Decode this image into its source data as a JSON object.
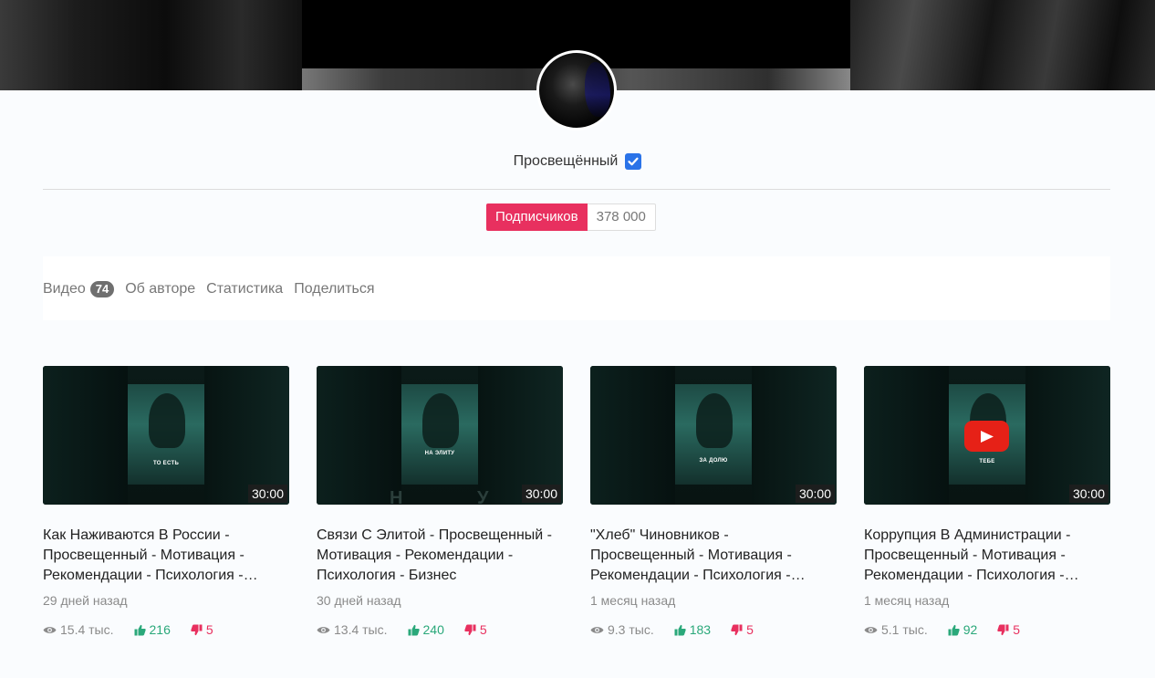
{
  "channel": {
    "name": "Просвещённый",
    "subscribe_label": "Подписчиков",
    "subscriber_count": "378 000"
  },
  "tabs": [
    {
      "label": "Видео",
      "badge": "74"
    },
    {
      "label": "Об авторе"
    },
    {
      "label": "Статистика"
    },
    {
      "label": "Поделиться"
    }
  ],
  "videos": [
    {
      "title": "Как Наживаются В России - Просвещенный - Мотивация - Рекомендации - Психология -…",
      "date": "29 дней назад",
      "duration": "30:00",
      "thumb_caption": "ТО ЕСТЬ",
      "views": "15.4 тыс.",
      "likes": "216",
      "dislikes": "5"
    },
    {
      "title": "Связи С Элитой - Просвещенный - Мотивация - Рекомендации - Психология - Бизнес",
      "date": "30 дней назад",
      "duration": "30:00",
      "thumb_caption": "НА ЭЛИТУ",
      "views": "13.4 тыс.",
      "likes": "240",
      "dislikes": "5"
    },
    {
      "title": "\"Хлеб\" Чиновников - Просвещенный - Мотивация - Рекомендации - Психология -…",
      "date": "1 месяц назад",
      "duration": "30:00",
      "thumb_caption": "ЗА ДОЛЮ",
      "views": "9.3 тыс.",
      "likes": "183",
      "dislikes": "5"
    },
    {
      "title": "Коррупция В Администрации - Просвещенный - Мотивация - Рекомендации - Психология -…",
      "date": "1 месяц назад",
      "duration": "30:00",
      "thumb_caption": "ТЕБЕ",
      "views": "5.1 тыс.",
      "likes": "92",
      "dislikes": "5"
    }
  ],
  "colors": {
    "accent": "#e8305f",
    "verified": "#2a73e8",
    "likes": "#2aa87a",
    "dislikes": "#e8305f"
  }
}
